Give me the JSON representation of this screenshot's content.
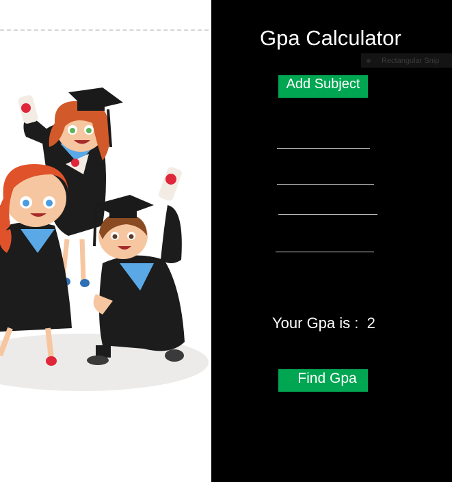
{
  "app": {
    "title": "Gpa Calculator"
  },
  "overlay": {
    "snip_label": "Rectangular Snip"
  },
  "actions": {
    "add_subject_label": "Add Subject",
    "find_gpa_label": "Find Gpa"
  },
  "subjects": [
    {
      "value": ""
    },
    {
      "value": ""
    },
    {
      "value": ""
    },
    {
      "value": ""
    }
  ],
  "result": {
    "label": "Your Gpa is :",
    "value": "2"
  },
  "illustration": {
    "subject": "graduates-celebrating",
    "colors": {
      "gown": "#1a1a1a",
      "collar": "#5aa9e6",
      "hair_red": "#e05a2a",
      "hair_brown": "#7a3b1f",
      "diploma_ribbon": "#e0263a"
    }
  },
  "colors": {
    "button": "#00a651",
    "background_right": "#000000",
    "background_left": "#ffffff",
    "text": "#ffffff"
  }
}
